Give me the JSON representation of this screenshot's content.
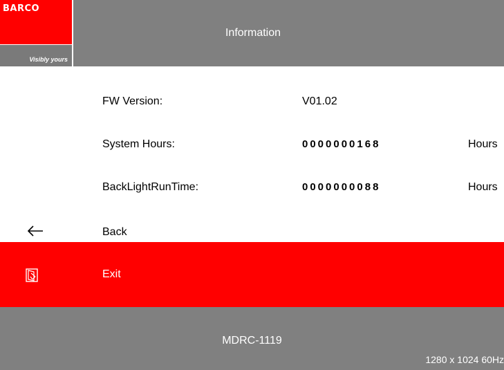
{
  "header": {
    "logo": {
      "brand": "BARCO",
      "tagline": "Visibly yours"
    },
    "title": "Information"
  },
  "info_rows": [
    {
      "label": "FW Version:",
      "value": "V01.02",
      "unit": ""
    },
    {
      "label": "System Hours:",
      "value": "0000000168",
      "unit": "Hours"
    },
    {
      "label": "BackLightRunTime:",
      "value": "0000000088",
      "unit": "Hours"
    }
  ],
  "menu": {
    "back": {
      "label": "Back",
      "icon": "back-arrow-icon"
    },
    "exit": {
      "label": "Exit",
      "icon": "exit-door-icon",
      "selected": true
    }
  },
  "footer": {
    "model": "MDRC-1119",
    "resolution": "1280 x 1024 60Hz"
  },
  "colors": {
    "header_bg": "#808080",
    "brand_red": "#ff0000",
    "selected_bg": "#ff0000",
    "text": "#000000",
    "text_light": "#ffffff"
  }
}
